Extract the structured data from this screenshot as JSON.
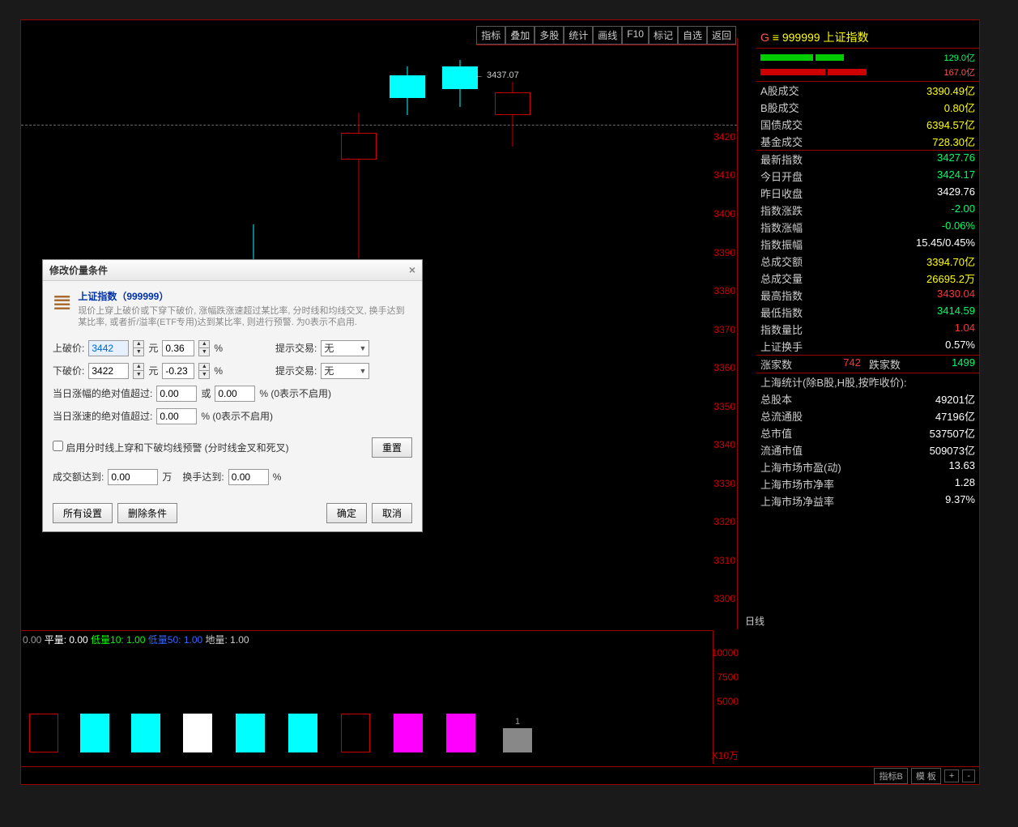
{
  "toolbar": {
    "items": [
      "指标",
      "叠加",
      "多股",
      "统计",
      "画线",
      "F10",
      "标记",
      "自选",
      "返回"
    ]
  },
  "chart_data": {
    "type": "candlestick",
    "y_ticks": [
      3420,
      3410,
      3400,
      3390,
      3380,
      3370,
      3360,
      3350,
      3340,
      3330,
      3320,
      3310,
      3300
    ],
    "label_point": "3437.07",
    "day_label": "日线"
  },
  "volume": {
    "legend_prefix": "0.00",
    "legend_ping": "平量: 0.00",
    "legend_di10": "低量10: 1.00",
    "legend_di50": "低量50: 1.00",
    "legend_diL": "地量: 1.00",
    "y_ticks": [
      "10000",
      "7500",
      "5000"
    ],
    "unit": "X10万"
  },
  "right": {
    "code_letter": "G",
    "code_sym": "≡",
    "code": "999999",
    "name": "上证指数",
    "bar1_val": "129.0亿",
    "bar2_val": "167.0亿",
    "rows": [
      {
        "l": "A股成交",
        "v": "3390.49亿",
        "c": "val-yellow"
      },
      {
        "l": "B股成交",
        "v": "0.80亿",
        "c": "val-yellow"
      },
      {
        "l": "国债成交",
        "v": "6394.57亿",
        "c": "val-yellow"
      },
      {
        "l": "基金成交",
        "v": "728.30亿",
        "c": "val-yellow"
      }
    ],
    "rows2": [
      {
        "l": "最新指数",
        "v": "3427.76",
        "c": "val-green"
      },
      {
        "l": "今日开盘",
        "v": "3424.17",
        "c": "val-green"
      },
      {
        "l": "昨日收盘",
        "v": "3429.76",
        "c": "val-white"
      },
      {
        "l": "指数涨跌",
        "v": "-2.00",
        "c": "val-green"
      },
      {
        "l": "指数涨幅",
        "v": "-0.06%",
        "c": "val-green"
      },
      {
        "l": "指数振幅",
        "v": "15.45/0.45%",
        "c": "val-white"
      },
      {
        "l": "总成交额",
        "v": "3394.70亿",
        "c": "val-yellow"
      },
      {
        "l": "总成交量",
        "v": "26695.2万",
        "c": "val-yellow"
      },
      {
        "l": "最高指数",
        "v": "3430.04",
        "c": "val-red"
      },
      {
        "l": "最低指数",
        "v": "3414.59",
        "c": "val-green"
      },
      {
        "l": "指数量比",
        "v": "1.04",
        "c": "val-red"
      },
      {
        "l": "上证换手",
        "v": "0.57%",
        "c": "val-white"
      }
    ],
    "adv_label": "涨家数",
    "adv_val": "742",
    "dec_label": "跌家数",
    "dec_val": "1499",
    "stat_header": "上海统计(除B股,H股,按昨收价):",
    "rows3": [
      {
        "l": "总股本",
        "v": "49201亿",
        "c": "val-white"
      },
      {
        "l": "总流通股",
        "v": "47196亿",
        "c": "val-white"
      },
      {
        "l": "总市值",
        "v": "537507亿",
        "c": "val-white"
      },
      {
        "l": "流通市值",
        "v": "509073亿",
        "c": "val-white"
      },
      {
        "l": "上海市场市盈(动)",
        "v": "13.63",
        "c": "val-white"
      },
      {
        "l": "上海市场市净率",
        "v": "1.28",
        "c": "val-white"
      },
      {
        "l": "上海市场净益率",
        "v": "9.37%",
        "c": "val-white"
      }
    ]
  },
  "dialog": {
    "title": "修改价量条件",
    "name": "上证指数（999999）",
    "desc": "现价上穿上破价或下穿下破价, 涨幅跌涨速超过某比率, 分时线和均线交叉, 换手达到某比率, 或者折/溢率(ETF专用)达到某比率, 则进行预警. 为0表示不启用.",
    "row_up_label": "上破价:",
    "row_up_price": "3442",
    "row_up_unit": "元",
    "row_up_pct": "0.36",
    "pct": "%",
    "row_hint_label": "提示交易:",
    "sel_none": "无",
    "row_dn_label": "下破价:",
    "row_dn_price": "3422",
    "row_dn_pct": "-0.23",
    "row_amp_label": "当日涨幅的绝对值超过:",
    "amp1": "0.00",
    "or": "或",
    "amp2": "0.00",
    "amp_note": "%  (0表示不启用)",
    "row_vel_label": "当日涨速的绝对值超过:",
    "vel": "0.00",
    "vel_note": "%  (0表示不启用)",
    "chk_label": "启用分时线上穿和下破均线预警 (分时线金叉和死叉)",
    "reset": "重置",
    "row_volamt_label": "成交额达到:",
    "volamt": "0.00",
    "wan": "万",
    "row_turn_label": "换手达到:",
    "turn": "0.00",
    "btn_all": "所有设置",
    "btn_del": "删除条件",
    "btn_ok": "确定",
    "btn_cancel": "取消"
  },
  "statusbar": {
    "items": [
      "指标B",
      "模 板",
      "+",
      "-"
    ]
  }
}
